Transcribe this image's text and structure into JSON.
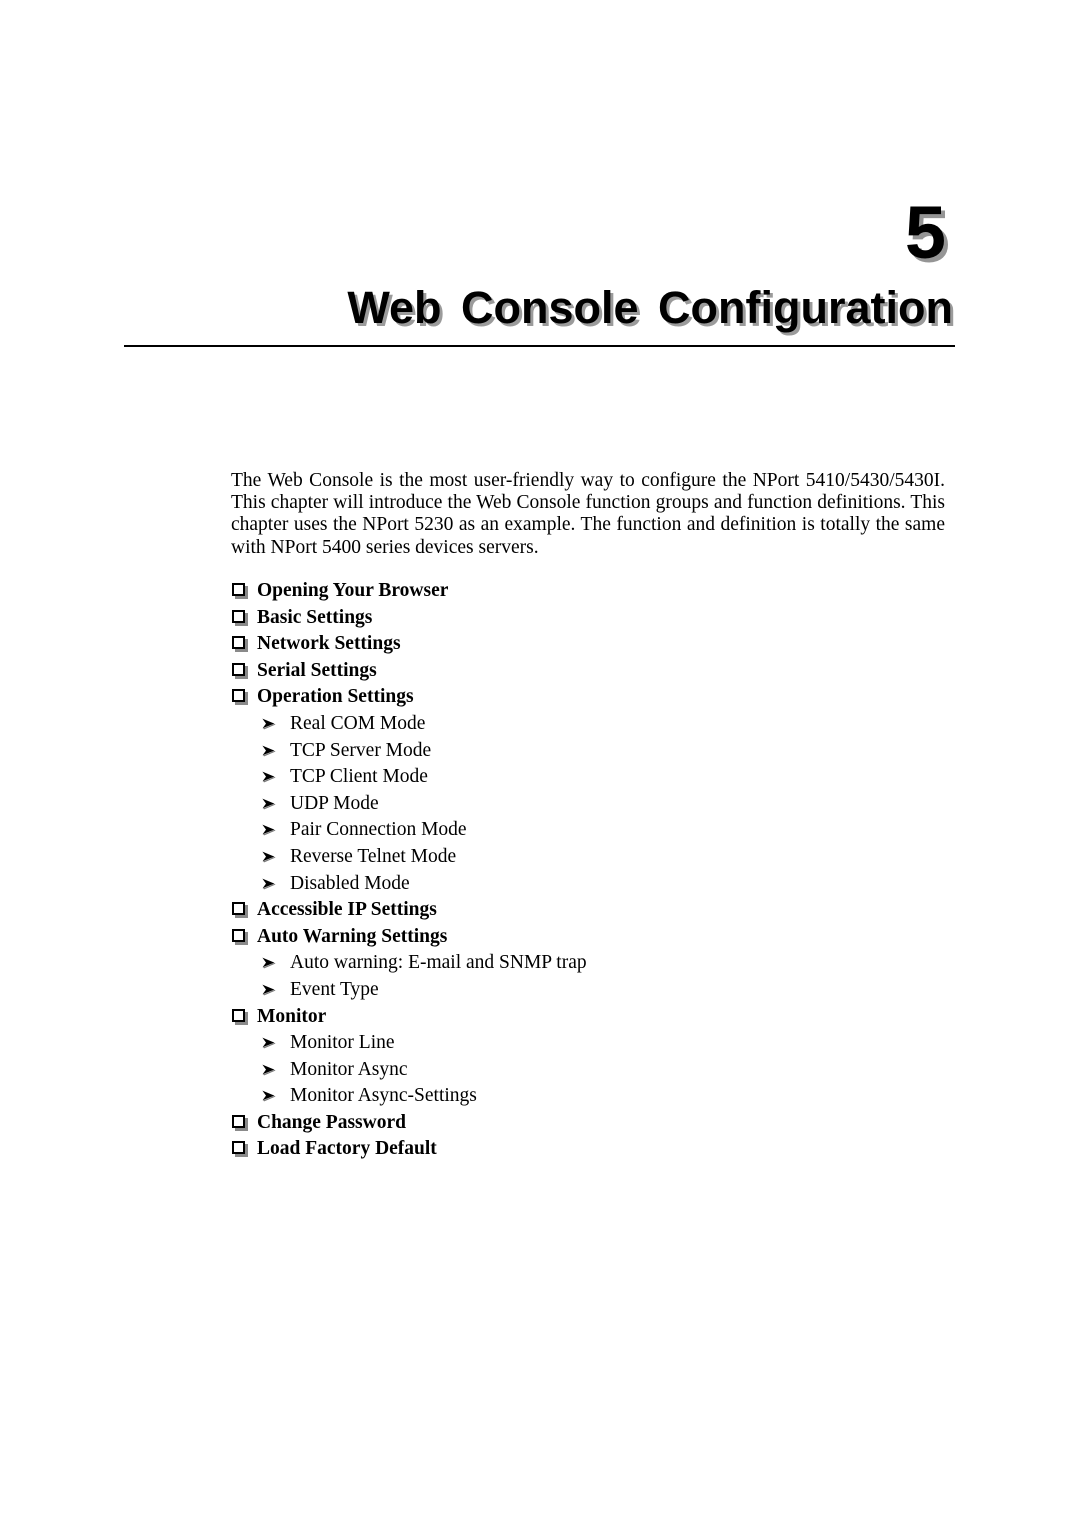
{
  "chapter": {
    "number": "5",
    "title": "Web Console Configuration"
  },
  "intro": {
    "paragraph": "The Web Console is the most user-friendly way to configure the NPort 5410/5430/5430I. This chapter will introduce the Web Console function groups and function definitions. This chapter uses the NPort 5230 as an example. The function and definition is totally the same with NPort 5400 series devices servers."
  },
  "outline": {
    "items": [
      {
        "level": 1,
        "bullet": "hollow-square-icon",
        "label": "Opening Your Browser"
      },
      {
        "level": 1,
        "bullet": "hollow-square-icon",
        "label": "Basic Settings"
      },
      {
        "level": 1,
        "bullet": "hollow-square-icon",
        "label": "Network Settings"
      },
      {
        "level": 1,
        "bullet": "hollow-square-icon",
        "label": "Serial Settings"
      },
      {
        "level": 1,
        "bullet": "hollow-square-icon",
        "label": "Operation Settings"
      },
      {
        "level": 2,
        "bullet": "arrowhead-icon",
        "label": "Real COM Mode"
      },
      {
        "level": 2,
        "bullet": "arrowhead-icon",
        "label": "TCP Server Mode"
      },
      {
        "level": 2,
        "bullet": "arrowhead-icon",
        "label": "TCP Client Mode"
      },
      {
        "level": 2,
        "bullet": "arrowhead-icon",
        "label": "UDP Mode"
      },
      {
        "level": 2,
        "bullet": "arrowhead-icon",
        "label": "Pair Connection Mode"
      },
      {
        "level": 2,
        "bullet": "arrowhead-icon",
        "label": "Reverse Telnet Mode"
      },
      {
        "level": 2,
        "bullet": "arrowhead-icon",
        "label": "Disabled Mode"
      },
      {
        "level": 1,
        "bullet": "hollow-square-icon",
        "label": "Accessible IP Settings"
      },
      {
        "level": 1,
        "bullet": "hollow-square-icon",
        "label": "Auto Warning Settings"
      },
      {
        "level": 2,
        "bullet": "arrowhead-icon",
        "label": "Auto warning: E-mail and SNMP trap"
      },
      {
        "level": 2,
        "bullet": "arrowhead-icon",
        "label": "Event Type"
      },
      {
        "level": 1,
        "bullet": "hollow-square-icon",
        "label": "Monitor"
      },
      {
        "level": 2,
        "bullet": "arrowhead-icon",
        "label": "Monitor Line"
      },
      {
        "level": 2,
        "bullet": "arrowhead-icon",
        "label": "Monitor Async"
      },
      {
        "level": 2,
        "bullet": "arrowhead-icon",
        "label": "Monitor Async-Settings"
      },
      {
        "level": 1,
        "bullet": "hollow-square-icon",
        "label": "Change Password"
      },
      {
        "level": 1,
        "bullet": "hollow-square-icon",
        "label": "Load Factory Default"
      }
    ]
  },
  "colors": {
    "text": "#000000",
    "page_background": "#ffffff",
    "shadow": "#8a8a8a",
    "rule": "#000000"
  }
}
